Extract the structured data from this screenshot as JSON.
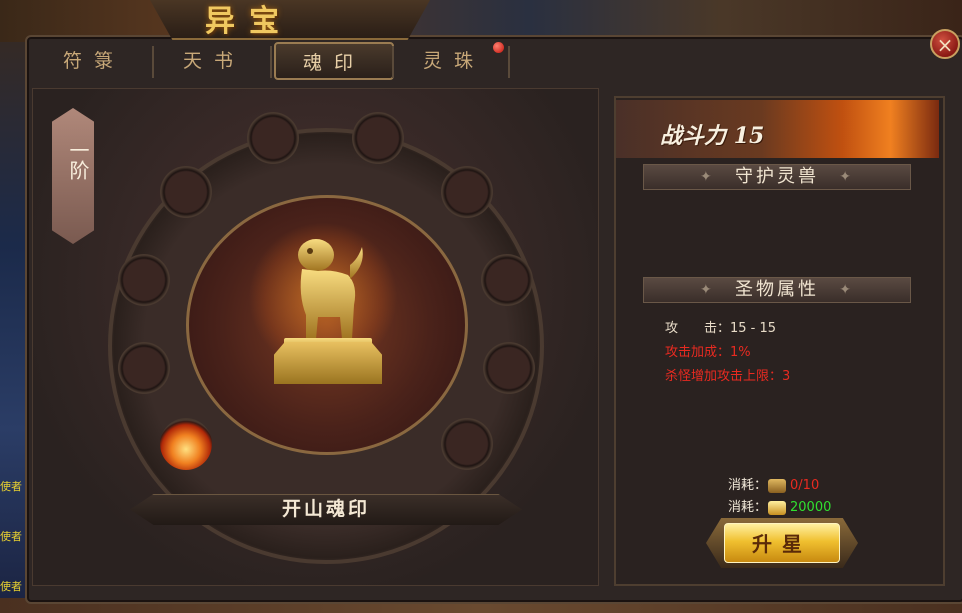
{
  "window": {
    "title": "异宝",
    "close_label": "×"
  },
  "tabs": [
    {
      "label": "符箓",
      "active": false
    },
    {
      "label": "天书",
      "active": false
    },
    {
      "label": "魂印",
      "active": true
    },
    {
      "label": "灵珠",
      "active": false,
      "has_notification": true
    }
  ],
  "side_text": [
    "使者",
    "使者",
    "使者"
  ],
  "rank": {
    "label": "一阶"
  },
  "seal": {
    "name": "开山魂印",
    "slots_total": 10,
    "slots_lit": 1
  },
  "panel": {
    "power_label": "战斗力",
    "power_value": "15",
    "section_guard": "守护灵兽",
    "section_attr": "圣物属性",
    "stats": [
      {
        "text": "攻　　击：15 - 15",
        "color": "#e8dcc8"
      },
      {
        "text": "攻击加成：1%",
        "color": "#e82a20"
      },
      {
        "text": "杀怪增加攻击上限：3",
        "color": "#e82a20"
      }
    ],
    "cost_label": "消耗：",
    "cost1_value": "0/10",
    "cost1_color": "#e82a20",
    "cost2_value": "20000",
    "cost2_color": "#30e030",
    "cost1_icon": "lion-seal-icon",
    "cost2_icon": "gold-ingot-icon",
    "upgrade_label": "升星"
  }
}
